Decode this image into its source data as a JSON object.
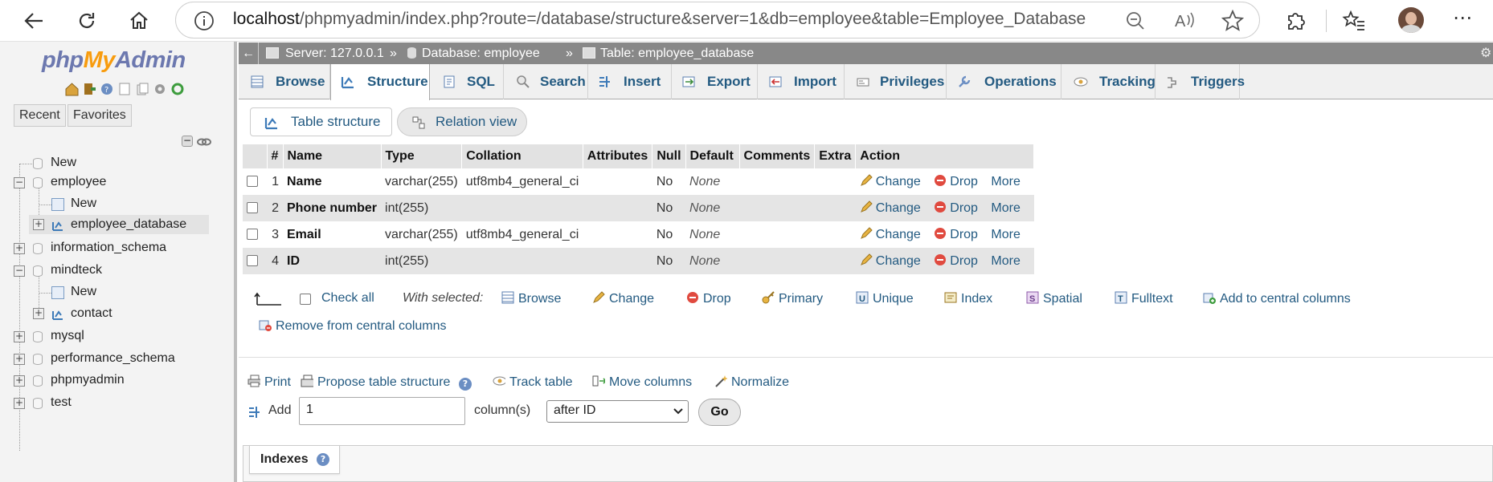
{
  "browser": {
    "url_host": "localhost",
    "url_path": "/phpmyadmin/index.php?route=/database/structure&server=1&db=employee&table=Employee_Database"
  },
  "leftnav": {
    "logo_php": "php",
    "logo_my": "My",
    "logo_admin": "Admin",
    "recent": "Recent",
    "favorites": "Favorites",
    "tree": {
      "new_root": "New",
      "employee": "employee",
      "employee_new": "New",
      "employee_database": "employee_database",
      "information_schema": "information_schema",
      "mindteck": "mindteck",
      "mindteck_new": "New",
      "contact": "contact",
      "mysql": "mysql",
      "performance_schema": "performance_schema",
      "phpmyadmin": "phpmyadmin",
      "test": "test"
    }
  },
  "breadcrumb": {
    "server": "Server: 127.0.0.1",
    "sep1": "»",
    "database": "Database: employee",
    "sep2": "»",
    "table": "Table: employee_database"
  },
  "tabs": [
    {
      "label": "Browse"
    },
    {
      "label": "Structure"
    },
    {
      "label": "SQL"
    },
    {
      "label": "Search"
    },
    {
      "label": "Insert"
    },
    {
      "label": "Export"
    },
    {
      "label": "Import"
    },
    {
      "label": "Privileges"
    },
    {
      "label": "Operations"
    },
    {
      "label": "Tracking"
    },
    {
      "label": "Triggers"
    }
  ],
  "subtabs": {
    "table_structure": "Table structure",
    "relation_view": "Relation view"
  },
  "table": {
    "headers": [
      "#",
      "Name",
      "Type",
      "Collation",
      "Attributes",
      "Null",
      "Default",
      "Comments",
      "Extra",
      "Action"
    ],
    "rows": [
      {
        "num": "1",
        "name": "Name",
        "type": "varchar(255)",
        "collation": "utf8mb4_general_ci",
        "null": "No",
        "default": "None"
      },
      {
        "num": "2",
        "name": "Phone number",
        "type": "int(255)",
        "collation": "",
        "null": "No",
        "default": "None"
      },
      {
        "num": "3",
        "name": "Email",
        "type": "varchar(255)",
        "collation": "utf8mb4_general_ci",
        "null": "No",
        "default": "None"
      },
      {
        "num": "4",
        "name": "ID",
        "type": "int(255)",
        "collation": "",
        "null": "No",
        "default": "None"
      }
    ],
    "action_change": "Change",
    "action_drop": "Drop",
    "action_more": "More"
  },
  "with_selected": {
    "check_all": "Check all",
    "label": "With selected:",
    "browse": "Browse",
    "change": "Change",
    "drop": "Drop",
    "primary": "Primary",
    "unique": "Unique",
    "index": "Index",
    "spatial": "Spatial",
    "fulltext": "Fulltext",
    "add_central": "Add to central columns",
    "remove_central": "Remove from central columns"
  },
  "tools": {
    "print": "Print",
    "propose": "Propose table structure",
    "track": "Track table",
    "move": "Move columns",
    "normalize": "Normalize"
  },
  "add_columns": {
    "label": "Add",
    "value": "1",
    "columns_label": "column(s)",
    "position": "after ID",
    "go": "Go"
  },
  "indexes": {
    "label": "Indexes"
  },
  "colors": {
    "link": "#235a81",
    "logo_blue": "#6c78af",
    "logo_orange": "#f89c0e",
    "breadcrumb_bg": "#888888"
  }
}
